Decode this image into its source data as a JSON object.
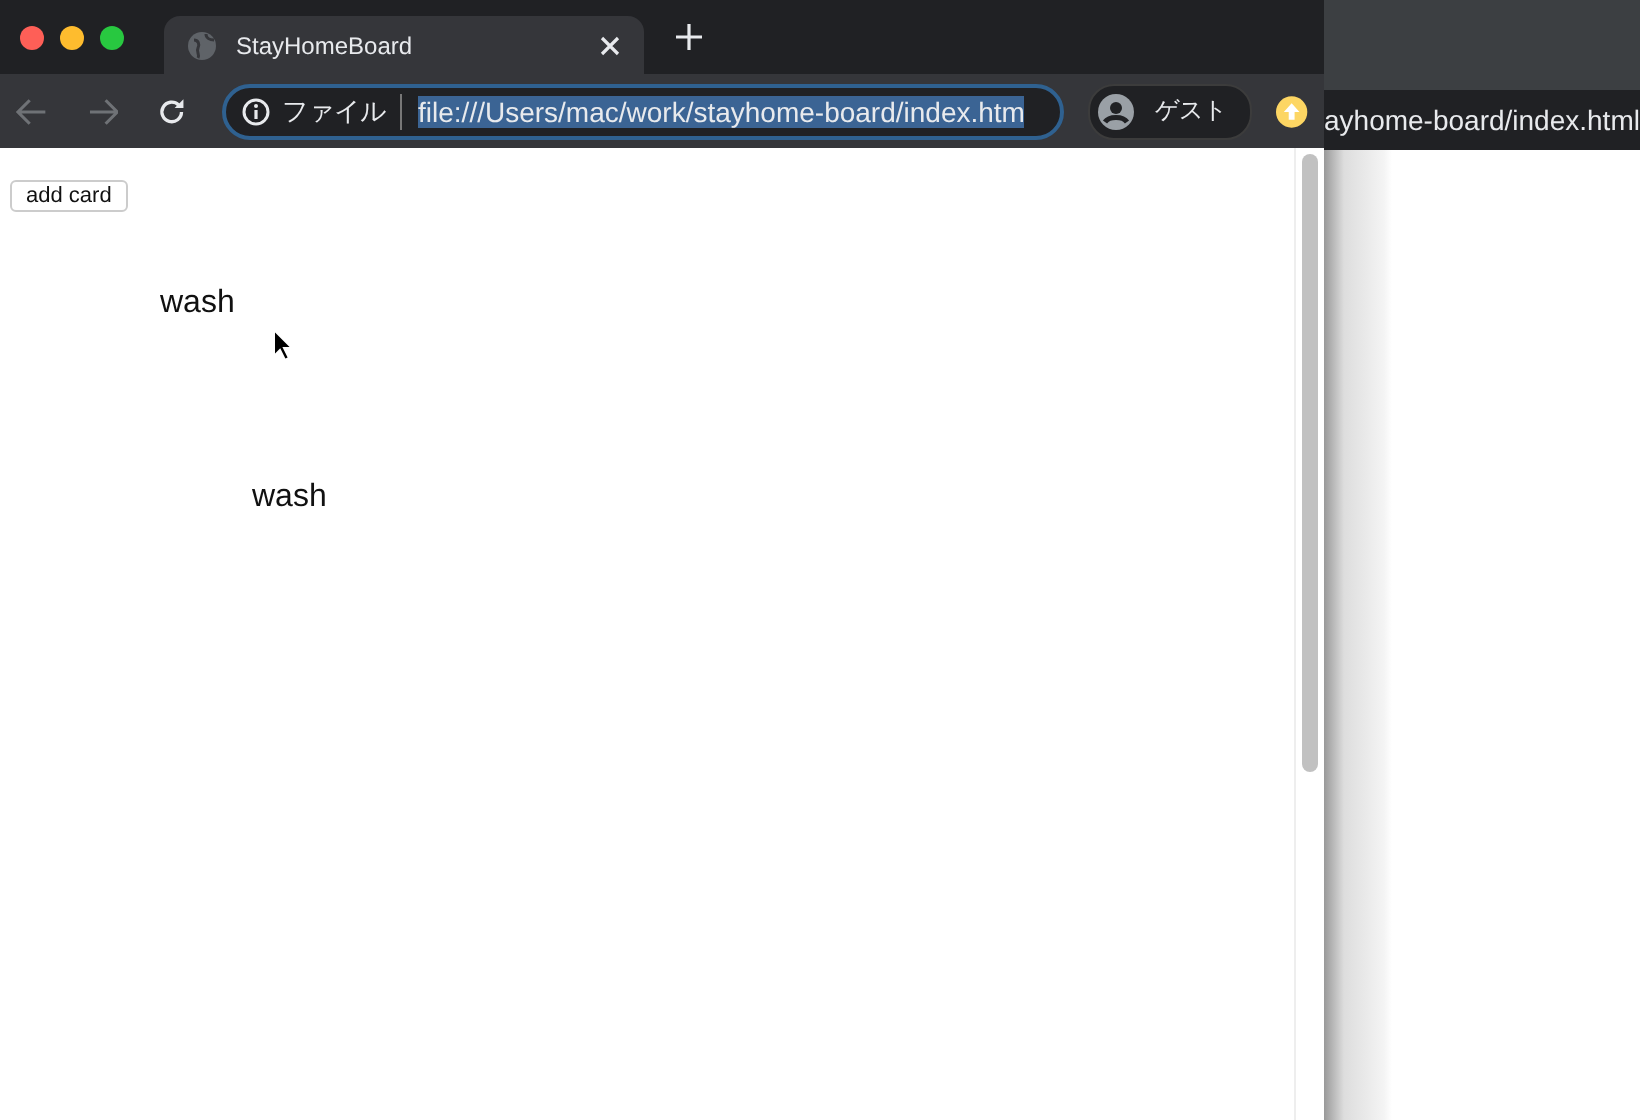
{
  "tab": {
    "title": "StayHomeBoard"
  },
  "address_bar": {
    "scheme_label": "ファイル",
    "url": "file:///Users/mac/work/stayhome-board/index.htm",
    "selected": true
  },
  "profile": {
    "label": "ゲスト"
  },
  "page": {
    "button": "add card",
    "cards": [
      {
        "text": "wash"
      },
      {
        "text": "wash"
      }
    ]
  },
  "background_window": {
    "url": "ayhome-board/index.html"
  }
}
